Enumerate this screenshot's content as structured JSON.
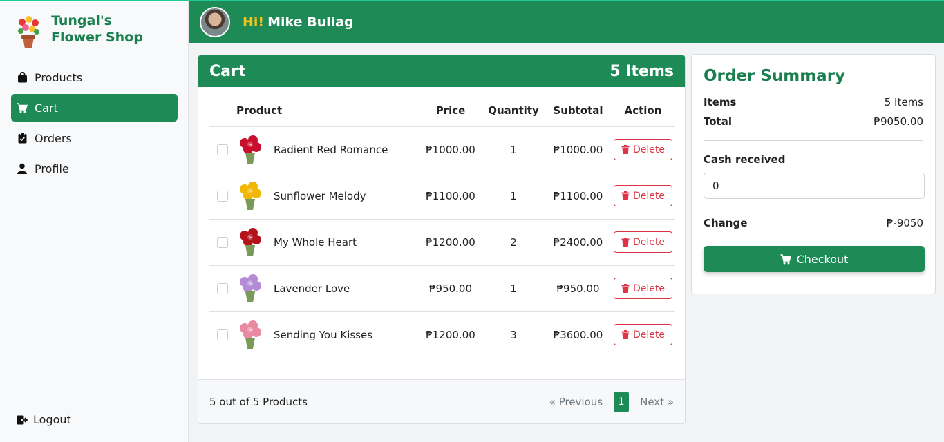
{
  "brand": {
    "line1": "Tungal's",
    "line2": "Flower Shop"
  },
  "nav": [
    {
      "label": "Products",
      "icon": "bag-icon",
      "active": false
    },
    {
      "label": "Cart",
      "icon": "cart-icon",
      "active": true
    },
    {
      "label": "Orders",
      "icon": "clipboard-icon",
      "active": false
    },
    {
      "label": "Profile",
      "icon": "person-icon",
      "active": false
    }
  ],
  "logout_label": "Logout",
  "topbar": {
    "hi": "Hi!",
    "name": "Mike Buliag"
  },
  "cart": {
    "title": "Cart",
    "count": "5 Items",
    "headers": {
      "product": "Product",
      "price": "Price",
      "quantity": "Quantity",
      "subtotal": "Subtotal",
      "action": "Action"
    },
    "delete_label": "Delete",
    "rows": [
      {
        "name": "Radient Red Romance",
        "price": "₱1000.00",
        "qty": "1",
        "subtotal": "₱1000.00",
        "color": "#c8102e"
      },
      {
        "name": "Sunflower Melody",
        "price": "₱1100.00",
        "qty": "1",
        "subtotal": "₱1100.00",
        "color": "#f2b705"
      },
      {
        "name": "My Whole Heart",
        "price": "₱1200.00",
        "qty": "2",
        "subtotal": "₱2400.00",
        "color": "#b5121b"
      },
      {
        "name": "Lavender Love",
        "price": "₱950.00",
        "qty": "1",
        "subtotal": "₱950.00",
        "color": "#b38bd6"
      },
      {
        "name": "Sending You Kisses",
        "price": "₱1200.00",
        "qty": "3",
        "subtotal": "₱3600.00",
        "color": "#e88aa0"
      }
    ],
    "footer": {
      "summary": "5 out of 5 Products",
      "prev": "« Previous",
      "page": "1",
      "next": "Next »"
    }
  },
  "order_summary": {
    "title": "Order Summary",
    "items_label": "Items",
    "items_value": "5 Items",
    "total_label": "Total",
    "total_value": "₱9050.00",
    "cash_label": "Cash received",
    "cash_value": "0",
    "change_label": "Change",
    "change_value": "₱-9050",
    "checkout_label": "Checkout"
  },
  "colors": {
    "primary": "#1e8a56",
    "accent": "#f5c518",
    "danger": "#dc3545"
  }
}
